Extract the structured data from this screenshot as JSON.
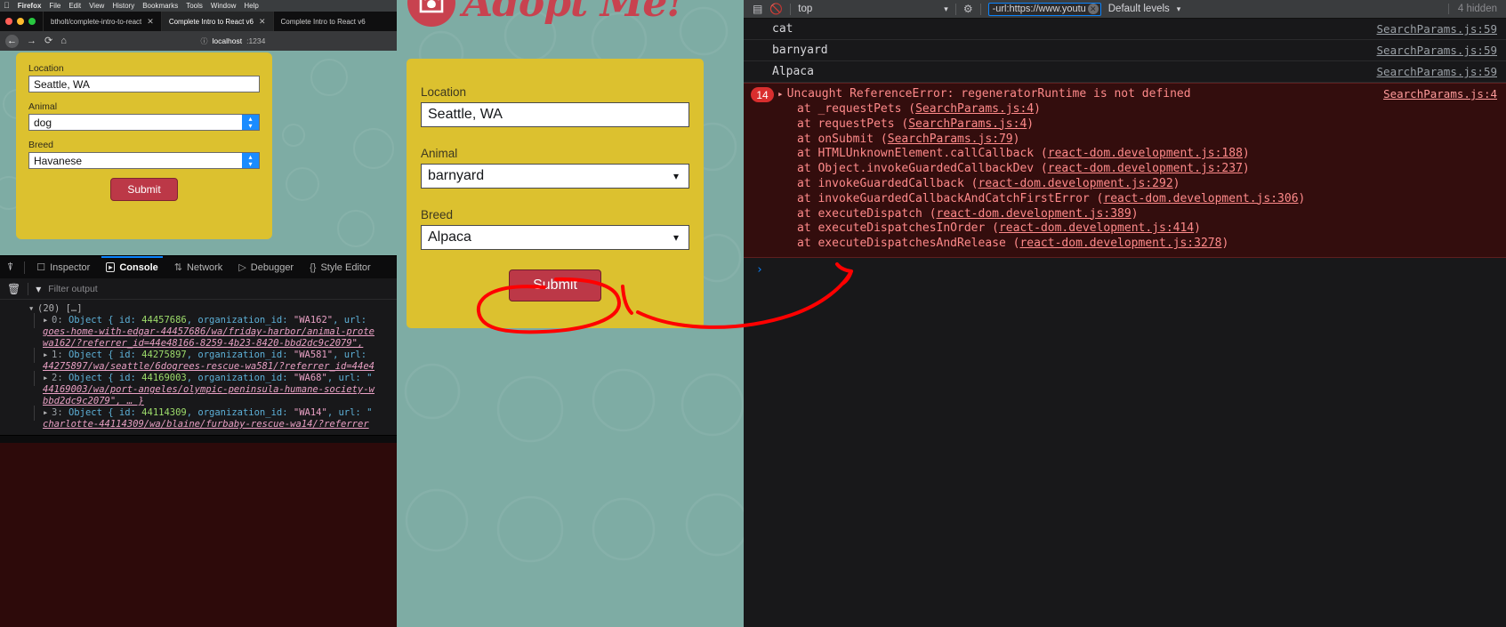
{
  "os_menubar": {
    "apple_icon": "apple-icon",
    "items": [
      "Firefox",
      "File",
      "Edit",
      "View",
      "History",
      "Bookmarks",
      "Tools",
      "Window",
      "Help"
    ]
  },
  "browser": {
    "traffic_lights": [
      "#ff5f57",
      "#febc2e",
      "#28c840"
    ],
    "tabs": [
      {
        "title": "btholt/complete-intro-to-react",
        "close": "✕",
        "active": false
      },
      {
        "title": "Complete Intro to React v6",
        "close": "✕",
        "active": true
      },
      {
        "title": "Complete Intro to React v6",
        "close": "",
        "active": false
      }
    ],
    "nav": {
      "back_icon": "←",
      "forward_icon": "→",
      "reload_icon": "⟳",
      "home_icon": "⌂",
      "info_icon": "ⓘ",
      "url_host": "localhost",
      "url_port": ":1234"
    }
  },
  "app_small": {
    "fields": [
      {
        "label": "Location",
        "value": "Seattle, WA",
        "type": "text"
      },
      {
        "label": "Animal",
        "value": "dog",
        "type": "select"
      },
      {
        "label": "Breed",
        "value": "Havanese",
        "type": "select"
      }
    ],
    "submit_label": "Submit"
  },
  "app_large": {
    "logo_text": "Adopt Me!",
    "logo_icon": "paw-badge-icon",
    "fields": [
      {
        "label": "Location",
        "value": "Seattle, WA",
        "type": "text"
      },
      {
        "label": "Animal",
        "value": "barnyard",
        "type": "select"
      },
      {
        "label": "Breed",
        "value": "Alpaca",
        "type": "select"
      }
    ],
    "submit_label": "Submit"
  },
  "devtools_left": {
    "picker_icon": "element-picker-icon",
    "tabs": [
      {
        "label": "Inspector",
        "icon": "inspector-icon",
        "active": false
      },
      {
        "label": "Console",
        "icon": "console-icon",
        "active": true
      },
      {
        "label": "Network",
        "icon": "network-icon",
        "active": false
      },
      {
        "label": "Debugger",
        "icon": "debugger-icon",
        "active": false
      },
      {
        "label": "Style Editor",
        "icon": "style-editor-icon",
        "active": false
      }
    ],
    "trash_icon": "trash-icon",
    "funnel_icon": "funnel-icon",
    "filter_placeholder": "Filter output",
    "overflow_label": "»",
    "console": {
      "array_header": "(20) […]",
      "rows": [
        {
          "index": "0:",
          "obj": "Object { id:",
          "id": "44457686",
          "org_key": ", organization_id:",
          "org": "\"WA162\"",
          "url_key": ", url:",
          "url_lines": [
            "goes-home-with-edgar-44457686/wa/friday-harbor/animal-prote",
            "wa162/?referrer_id=44e48166-8259-4b23-8420-bbd2dc9c2079\","
          ]
        },
        {
          "index": "1:",
          "obj": "Object { id:",
          "id": "44275897",
          "org_key": ", organization_id:",
          "org": "\"WA581\"",
          "url_key": ", url:",
          "url_lines": [
            "44275897/wa/seattle/6dogrees-rescue-wa581/?referrer_id=44e4"
          ]
        },
        {
          "index": "2:",
          "obj": "Object { id:",
          "id": "44169003",
          "org_key": ", organization_id:",
          "org": "\"WA68\"",
          "url_key": ", url: \"",
          "url_lines": [
            "44169003/wa/port-angeles/olympic-peninsula-humane-society-w",
            "bbd2dc9c2079\", … }"
          ]
        },
        {
          "index": "3:",
          "obj": "Object { id:",
          "id": "44114309",
          "org_key": ", organization_id:",
          "org": "\"WA14\"",
          "url_key": ", url: \"",
          "url_lines": [
            "charlotte-44114309/wa/blaine/furbaby-rescue-wa14/?referrer"
          ]
        }
      ]
    }
  },
  "devtools_right": {
    "toolbar": {
      "split_console_icon": "split-console-icon",
      "block_icon": "no-entry-icon",
      "context": "top",
      "context_caret": "▾",
      "settings_icon": "gear-icon",
      "filter_value": "-url:https://www.youtu",
      "filter_clear_icon": "✕",
      "levels_label": "Default levels",
      "levels_caret": "▾",
      "hidden_label": "4 hidden"
    },
    "log_rows": [
      {
        "text": "cat",
        "source": "SearchParams.js:59"
      },
      {
        "text": "barnyard",
        "source": "SearchParams.js:59"
      },
      {
        "text": "Alpaca",
        "source": "SearchParams.js:59"
      }
    ],
    "error": {
      "count": "14",
      "twisty": "▸",
      "message": "Uncaught ReferenceError: regeneratorRuntime is not defined",
      "source": "SearchParams.js:4",
      "frames": [
        {
          "at": "at _requestPets (",
          "link": "SearchParams.js:4",
          "close": ")"
        },
        {
          "at": "at requestPets (",
          "link": "SearchParams.js:4",
          "close": ")"
        },
        {
          "at": "at onSubmit (",
          "link": "SearchParams.js:79",
          "close": ")"
        },
        {
          "at": "at HTMLUnknownElement.callCallback (",
          "link": "react-dom.development.js:188",
          "close": ")"
        },
        {
          "at": "at Object.invokeGuardedCallbackDev (",
          "link": "react-dom.development.js:237",
          "close": ")"
        },
        {
          "at": "at invokeGuardedCallback (",
          "link": "react-dom.development.js:292",
          "close": ")"
        },
        {
          "at": "at invokeGuardedCallbackAndCatchFirstError (",
          "link": "react-dom.development.js:306",
          "close": ")"
        },
        {
          "at": "at executeDispatch (",
          "link": "react-dom.development.js:389",
          "close": ")"
        },
        {
          "at": "at executeDispatchesInOrder (",
          "link": "react-dom.development.js:414",
          "close": ")"
        },
        {
          "at": "at executeDispatchesAndRelease (",
          "link": "react-dom.development.js:3278",
          "close": ")"
        }
      ]
    },
    "prompt_symbol": "›"
  },
  "annotation": {
    "color": "#ff0000",
    "description": "hand-drawn red ellipse around Submit button with arrow pointing to console prompt"
  },
  "colors": {
    "page_teal": "#7eaca4",
    "form_yellow": "#dcc12f",
    "brand_red": "#c8424f",
    "submit_red": "#bc3847",
    "error_bg": "#330d0d",
    "accent_blue": "#0a84ff"
  }
}
